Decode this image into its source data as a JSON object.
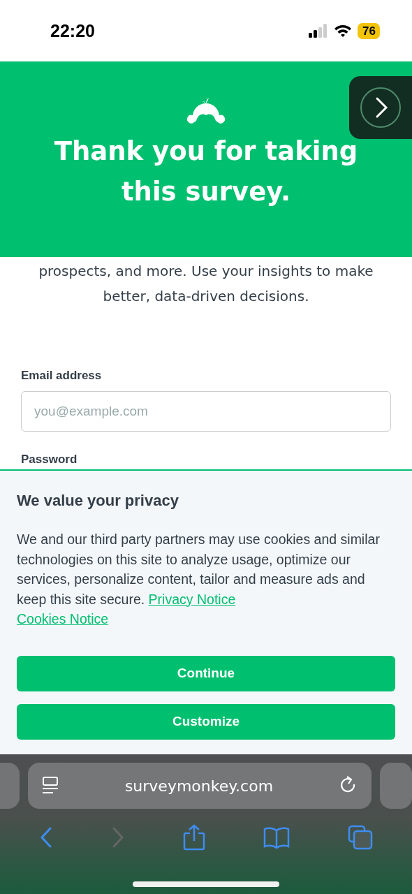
{
  "status_bar": {
    "time": "22:20",
    "battery": "76"
  },
  "header": {
    "title": "Thank you for taking this survey."
  },
  "intro": {
    "text": "prospects, and more. Use your insights to make better, data-driven decisions."
  },
  "form": {
    "fields": [
      {
        "label": "Email address",
        "placeholder": "you@example.com"
      }
    ],
    "next_label": "Password"
  },
  "cookie_banner": {
    "title": "We value your privacy",
    "body": "We and our third party partners may use cookies and similar technologies on this site to analyze usage, optimize our services, personalize content, tailor and measure ads and keep this site secure.",
    "links": [
      "Privacy Notice",
      "Cookies Notice"
    ],
    "buttons": [
      "Continue",
      "Customize"
    ]
  },
  "browser": {
    "url": "surveymonkey.com",
    "back_disabled": false,
    "forward_disabled": true
  }
}
